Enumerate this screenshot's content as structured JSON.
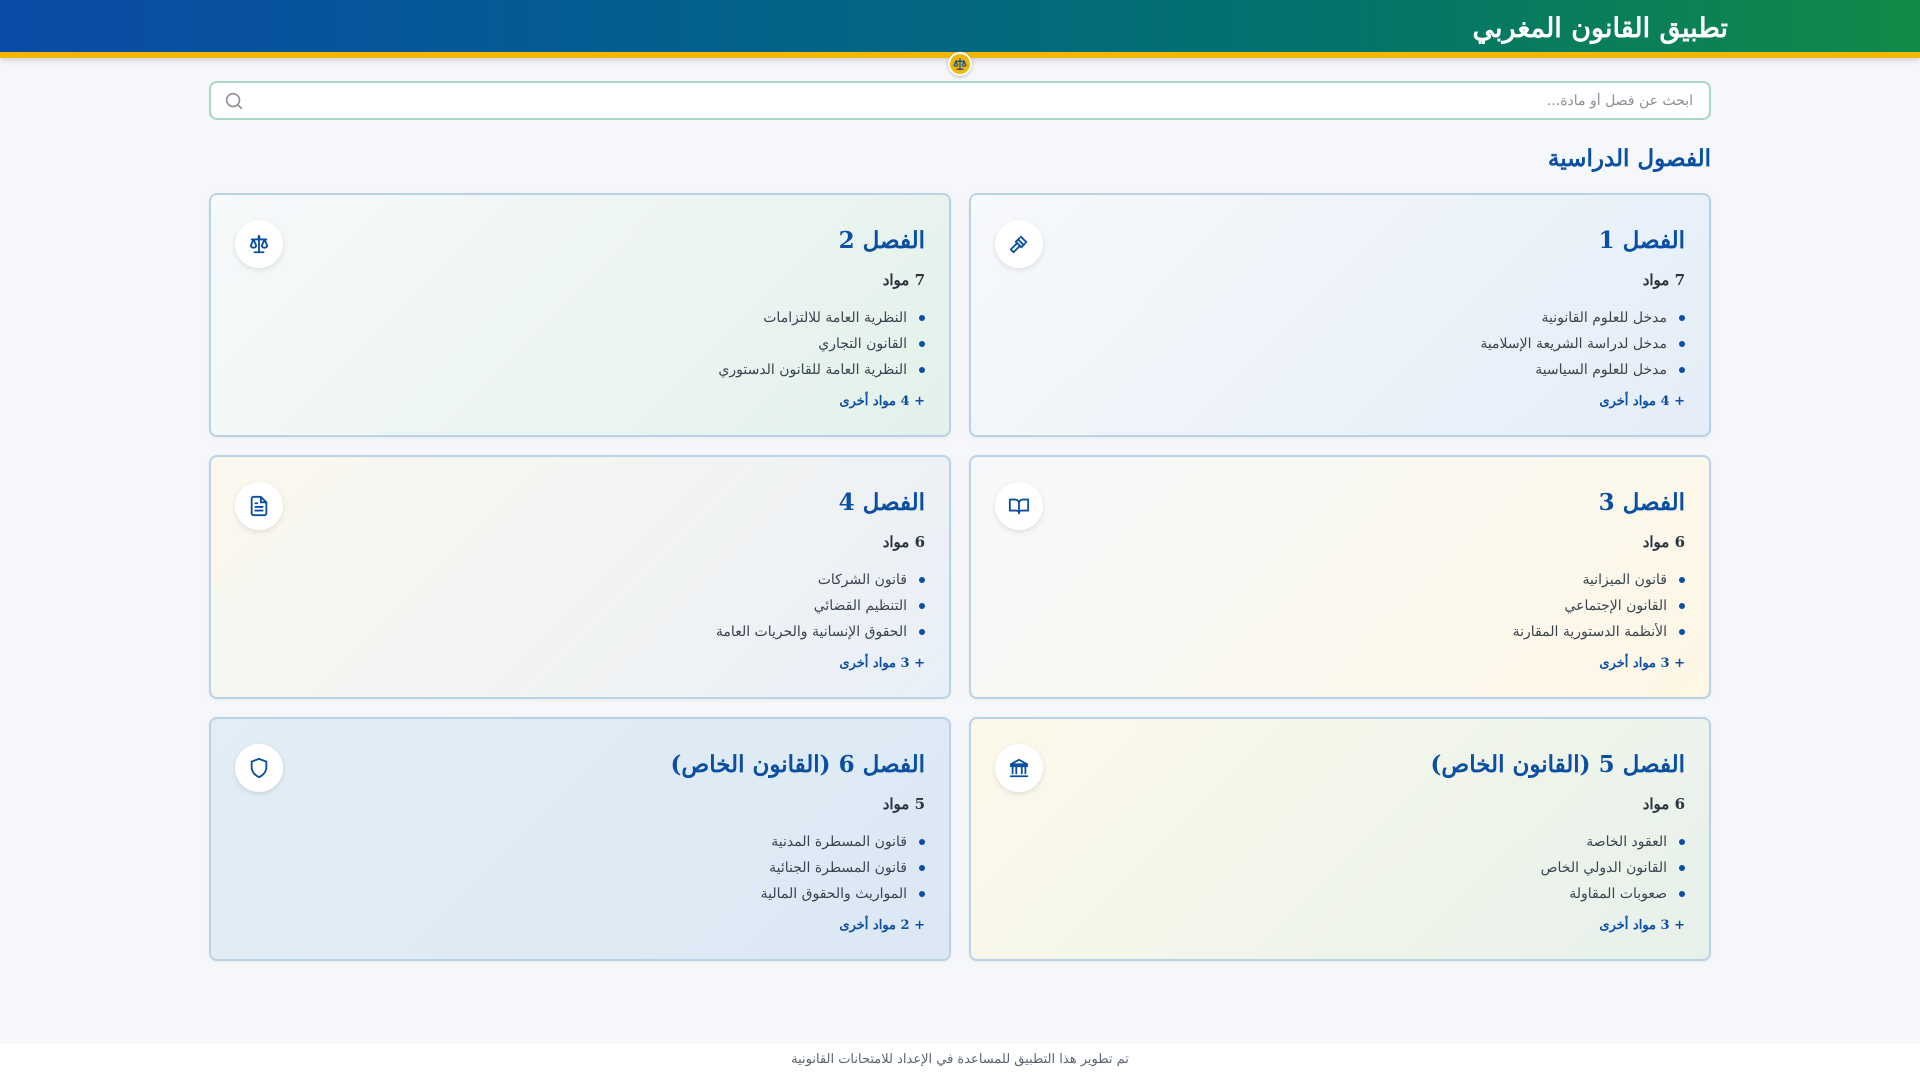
{
  "header": {
    "title": "تطبيق القانون المغربي",
    "emblem_icon": "scale-icon",
    "accent_color": "#f2b705"
  },
  "search": {
    "placeholder": "ابحث عن فصل أو مادة...",
    "value": "",
    "icon": "search-icon"
  },
  "section_title": "الفصول الدراسية",
  "semesters": [
    {
      "title": "الفصل 1",
      "count": "7 مواد",
      "icon": "gavel-icon",
      "subjects": [
        "مدخل للعلوم القانونية",
        "مدخل لدراسة الشريعة الإسلامية",
        "مدخل للعلوم السياسية"
      ],
      "more": "+ 4 مواد أخرى"
    },
    {
      "title": "الفصل 2",
      "count": "7 مواد",
      "icon": "scale-icon",
      "subjects": [
        "النظرية العامة للالتزامات",
        "القانون التجاري",
        "النظرية العامة للقانون الدستوري"
      ],
      "more": "+ 4 مواد أخرى"
    },
    {
      "title": "الفصل 3",
      "count": "6 مواد",
      "icon": "book-icon",
      "subjects": [
        "قانون الميزانية",
        "القانون الإجتماعي",
        "الأنظمة الدستورية المقارنة"
      ],
      "more": "+ 3 مواد أخرى"
    },
    {
      "title": "الفصل 4",
      "count": "6 مواد",
      "icon": "document-icon",
      "subjects": [
        "قانون الشركات",
        "التنظيم القضائي",
        "الحقوق الإنسانية والحريات العامة"
      ],
      "more": "+ 3 مواد أخرى"
    },
    {
      "title": "الفصل 5 (القانون الخاص)",
      "count": "6 مواد",
      "icon": "building-icon",
      "subjects": [
        "العقود الخاصة",
        "القانون الدولي الخاص",
        "صعوبات المقاولة"
      ],
      "more": "+ 3 مواد أخرى"
    },
    {
      "title": "الفصل 6 (القانون الخاص)",
      "count": "5 مواد",
      "icon": "shield-icon",
      "subjects": [
        "قانون المسطرة المدنية",
        "قانون المسطرة الجنائية",
        "المواريث والحقوق المالية"
      ],
      "more": "+ 2 مواد أخرى"
    }
  ],
  "footer": {
    "text": "تم تطوير هذا التطبيق للمساعدة في الإعداد للامتحانات القانونية"
  }
}
